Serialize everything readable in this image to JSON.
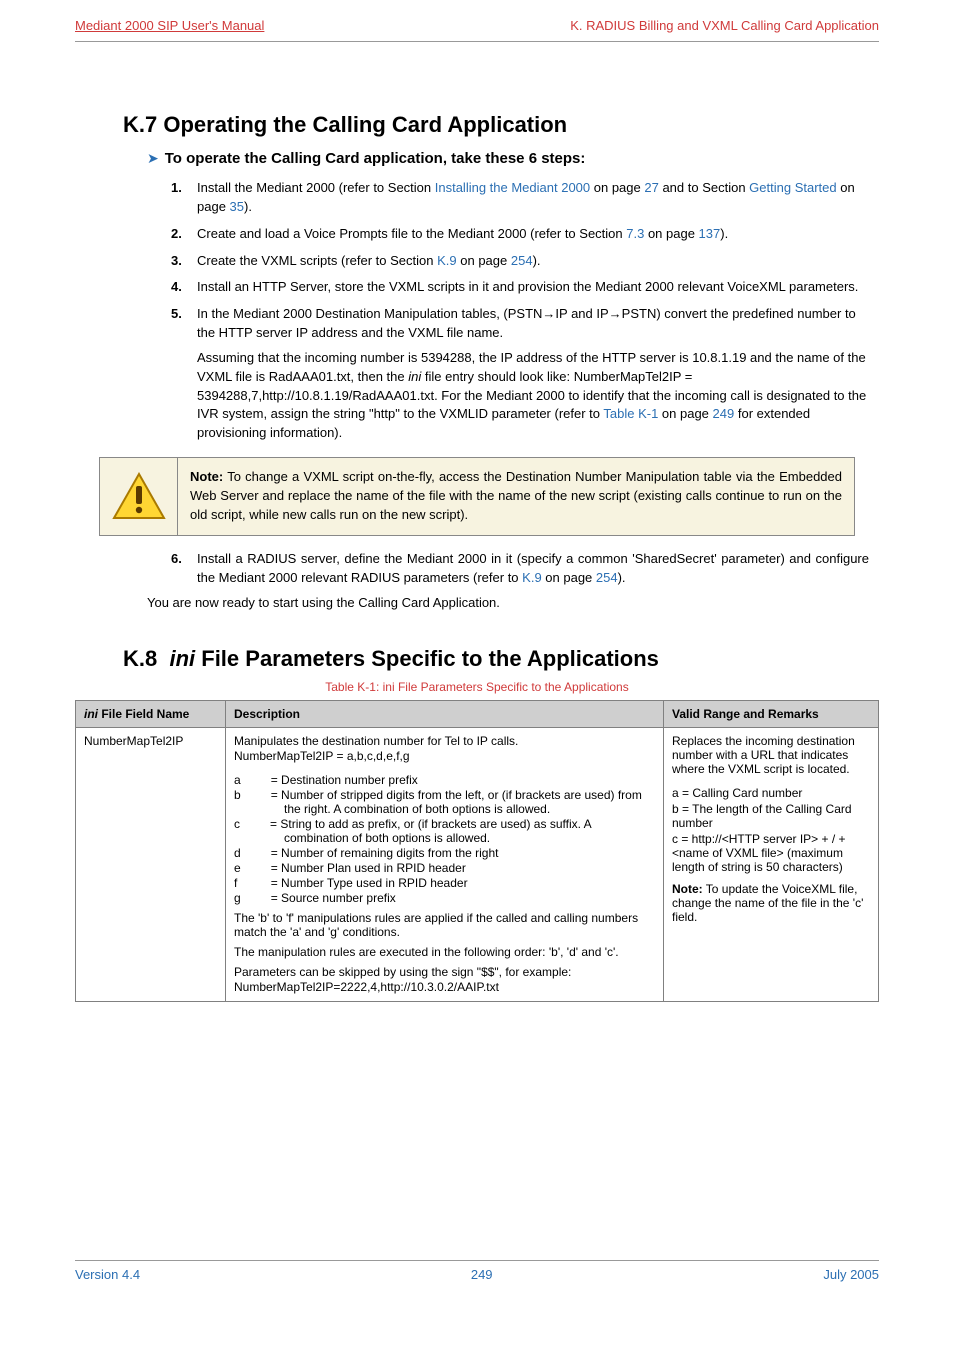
{
  "header": {
    "left": "Mediant 2000 SIP User's Manual",
    "right": "K. RADIUS Billing and VXML Calling Card Application"
  },
  "section": {
    "heading": "K.7 Operating the Calling Card Application",
    "arrow_label": "To operate the Calling Card application, take these 6 steps:"
  },
  "steps": {
    "s1a": "Install the Mediant 2000 (refer to Section ",
    "s1_link1": "Installing the Mediant 2000",
    "s1b": " on page ",
    "s1_link2": "27",
    "s1c": " and to Section ",
    "s1_link3": "Getting Started",
    "s1d": " on page ",
    "s1_link4": "35",
    "s1e": ").",
    "s2a": "Create and load a Voice Prompts file to the Mediant 2000 (refer to Section ",
    "s2_link1": "7.3",
    "s2b": " on page ",
    "s2_link2": "137",
    "s2c": ").",
    "s3a": "Create the VXML scripts (refer to Section ",
    "s3_link1": "K.9",
    "s3b": " on page ",
    "s3_link2": "254",
    "s3c": ").",
    "s4": "Install an HTTP Server, store the VXML scripts in it and provision the Mediant 2000 relevant VoiceXML parameters.",
    "s5a": "In the Mediant 2000 Destination Manipulation tables, (PSTN→IP and IP→PSTN) convert the predefined number to the HTTP server IP address and the VXML file name.",
    "s5b_1": "Assuming that the incoming number is 5394288, the IP address of the HTTP server is 10.8.1.19 and the name of the VXML file is RadAAA01.txt, then the ",
    "s5b_ini": "ini",
    "s5b_2": " file entry should look like: NumberMapTel2IP = 5394288,7,http://10.8.1.19/RadAAA01.txt. For the Mediant 2000 to identify that the incoming call is designated to the IVR system, assign the string \"http\" to the VXMLID parameter (refer to ",
    "s5b_link1": "Table K-1",
    "s5b_3": " on page ",
    "s5b_link2": "249",
    "s5b_4": " for extended provisioning information).",
    "s6a": "Install a RADIUS server, define the Mediant 2000 in it (specify a common 'SharedSecret' parameter) and configure the Mediant 2000 relevant RADIUS parameters (refer to ",
    "s6_link1": "K.9",
    "s6b": " on page ",
    "s6_link2": "254",
    "s6c": ")."
  },
  "note": {
    "label": "Note:",
    "text": " To change a VXML script on-the-fly, access the Destination Number Manipulation table via the Embedded Web Server and replace the name of the file with the name of the new script (existing calls continue to run on the old script, while new calls run on the new script)."
  },
  "ready": "You are now ready to start using the Calling Card Application.",
  "table_section": {
    "heading": "K.8 ini File Parameters Specific to the Applications",
    "caption": "Table K-1: ini File Parameters Specific to the Applications"
  },
  "table": {
    "headers": {
      "ini": "ini File Field Name",
      "desc": "Description",
      "valid": "Valid Range and Remarks"
    },
    "row1": {
      "ini": "NumberMapTel2IP",
      "desc_intro1": "Manipulates the destination number for Tel to IP calls.",
      "desc_intro2": "NumberMapTel2IP = a,b,c,d,e,f,g",
      "a": "= Destination number prefix",
      "b": "= Number of stripped digits from the left, or (if brackets are used) from the right. A combination of both options is allowed.",
      "c": "= String to add as prefix, or (if brackets are used) as suffix. A combination of both options is allowed.",
      "d": "= Number of remaining digits from the right",
      "e": "= Number Plan used in RPID header",
      "f": "= Number Type used in RPID header",
      "g": "= Source number prefix",
      "desc_p1": "The 'b' to 'f' manipulations rules are applied if the called and calling numbers match the 'a' and 'g' conditions.",
      "desc_p2": "The manipulation rules are executed in the following order: 'b', 'd' and 'c'.",
      "desc_p3": "Parameters can be skipped by using the sign \"$$\", for example:",
      "desc_p4": "NumberMapTel2IP=2222,4,http://10.3.0.2/AAIP.txt",
      "val_p1": "Replaces the incoming destination number with a URL that indicates where the VXML script is located.",
      "val_a": "a = Calling Card number",
      "val_b": "b = The length of the Calling Card number",
      "val_c": "c = http://<HTTP server IP> + / + <name of VXML file> (maximum length of string is 50 characters)",
      "val_note_label": "Note:",
      "val_note": " To update the VoiceXML file, change the name of the file in the 'c' field."
    }
  },
  "footer": {
    "left": "Version 4.4",
    "center": "249",
    "right": "July 2005"
  }
}
